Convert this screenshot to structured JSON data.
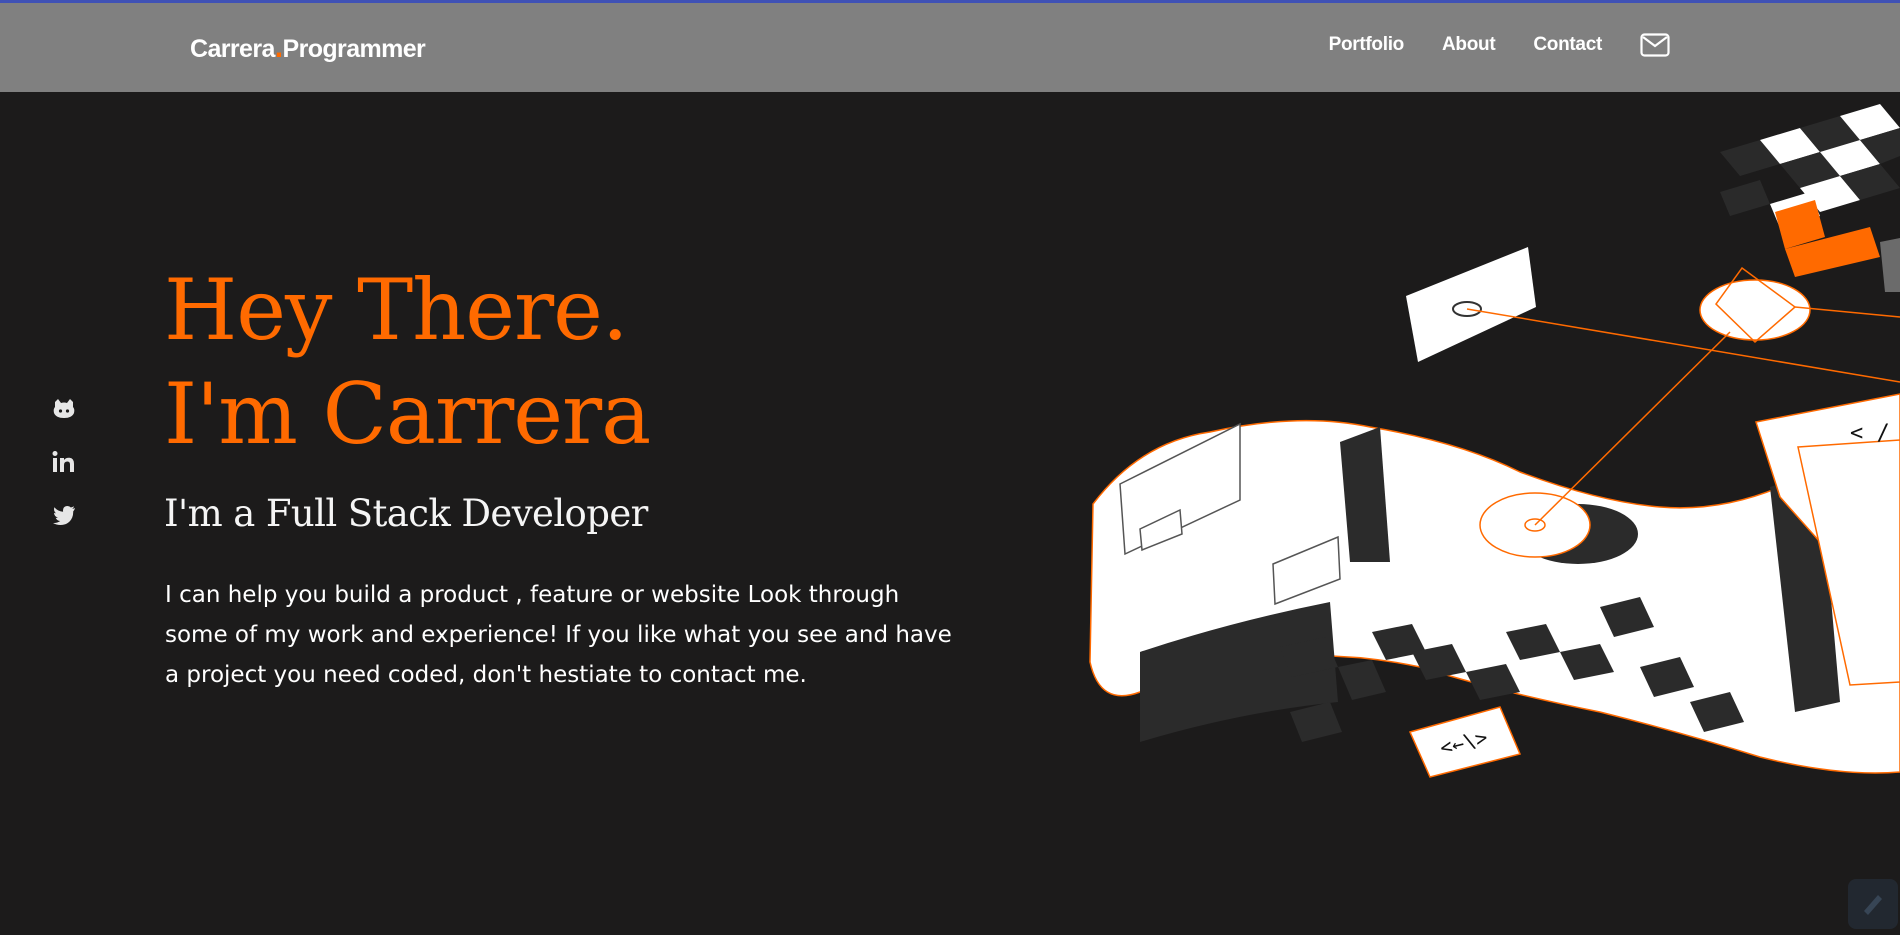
{
  "header": {
    "logo": {
      "part1": "Carrera",
      "dot": ".",
      "part2": "Programmer"
    },
    "nav": [
      {
        "label": "Portfolio"
      },
      {
        "label": "About"
      },
      {
        "label": "Contact"
      }
    ],
    "mail_icon": "envelope-icon"
  },
  "social": [
    {
      "icon": "github-icon"
    },
    {
      "icon": "linkedin-icon"
    },
    {
      "icon": "twitter-icon"
    }
  ],
  "hero": {
    "title_line1": "Hey There.",
    "title_line2": "I'm Carrera",
    "subtitle": "I'm a Full Stack Developer",
    "description": "I can help you build a product , feature or website Look through some of my work and experience! If you like what you see and have a project you need coded, don't hestiate to contact me."
  },
  "illustration": {
    "code_tag_1": "<←\\>",
    "code_tag_2": "< /"
  },
  "colors": {
    "accent": "#ff6a00",
    "background": "#1c1b1b",
    "header": "#808080",
    "topline": "#3f51b5"
  }
}
